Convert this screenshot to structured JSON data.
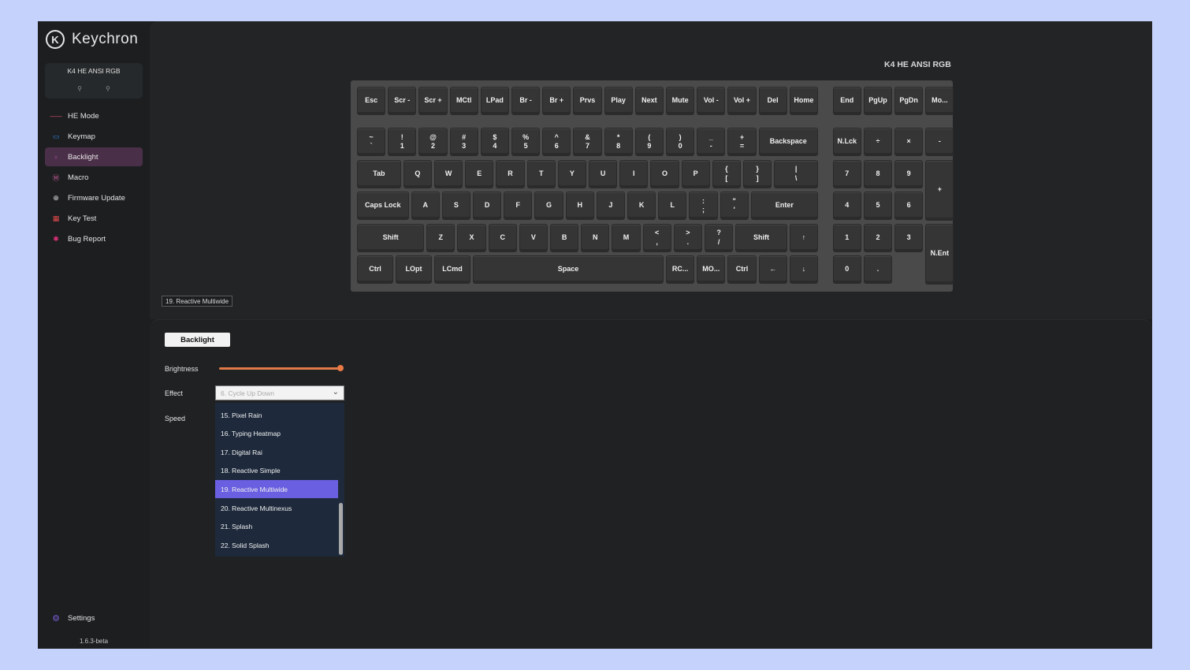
{
  "app": {
    "brand": "Keychron"
  },
  "device": {
    "name": "K4 HE ANSI RGB",
    "icons": [
      "link-icon",
      "link-icon"
    ]
  },
  "sidebar": {
    "items": [
      {
        "label": "HE Mode",
        "icon": "he-mode-icon",
        "color": "#e0506a",
        "glyph": "‒‒‒",
        "active": false
      },
      {
        "label": "Keymap",
        "icon": "keymap-icon",
        "color": "#2f7fd0",
        "glyph": "▭",
        "active": false
      },
      {
        "label": "Backlight",
        "icon": "bulb-icon",
        "color": "#a84ca0",
        "glyph": "♁",
        "active": true
      },
      {
        "label": "Macro",
        "icon": "macro-icon",
        "color": "#d060a0",
        "glyph": "Ⓜ",
        "active": false
      },
      {
        "label": "Firmware Update",
        "icon": "firmware-icon",
        "color": "#dcdcdc",
        "glyph": "⊕",
        "active": false
      },
      {
        "label": "Key Test",
        "icon": "key-test-icon",
        "color": "#e04a4a",
        "glyph": "▦",
        "active": false
      },
      {
        "label": "Bug Report",
        "icon": "bug-icon",
        "color": "#e0307a",
        "glyph": "✱",
        "active": false
      }
    ],
    "settings_label": "Settings",
    "version": "1.6.3-beta"
  },
  "keyboard": {
    "title": "K4 HE ANSI RGB",
    "rows": [
      [
        "Esc",
        "Scr -",
        "Scr +",
        "MCtl",
        "LPad",
        "Br -",
        "Br +",
        "Prvs",
        "Play",
        "Next",
        "Mute",
        "Vol -",
        "Vol +",
        "Del",
        "Home",
        "End",
        "PgUp",
        "PgDn",
        "Mo..."
      ],
      [
        "~\n`",
        "!\n1",
        "@\n2",
        "#\n3",
        "$\n4",
        "%\n5",
        "^\n6",
        "&\n7",
        "*\n8",
        "(\n9",
        ")\n0",
        "_\n-",
        "+\n=",
        "Backspace",
        "N.Lck",
        "÷",
        "×",
        "-"
      ],
      [
        "Tab",
        "Q",
        "W",
        "E",
        "R",
        "T",
        "Y",
        "U",
        "I",
        "O",
        "P",
        "{\n[",
        "}\n]",
        "|\n\\",
        "7",
        "8",
        "9",
        "+"
      ],
      [
        "Caps Lock",
        "A",
        "S",
        "D",
        "F",
        "G",
        "H",
        "J",
        "K",
        "L",
        ":\n;",
        "\"\n'",
        "Enter",
        "4",
        "5",
        "6"
      ],
      [
        "Shift",
        "Z",
        "X",
        "C",
        "V",
        "B",
        "N",
        "M",
        "<\n,",
        ">\n.",
        "?\n/",
        "Shift",
        "↑",
        "1",
        "2",
        "3",
        "N.Ent"
      ],
      [
        "Ctrl",
        "LOpt",
        "LCmd",
        "Space",
        "RC...",
        "MO...",
        "Ctrl",
        "←",
        "↓",
        "→",
        "0",
        "."
      ]
    ]
  },
  "current_effect_tag": "19. Reactive Multiwide",
  "panel": {
    "tab_label": "Backlight",
    "brightness_label": "Brightness",
    "brightness_value": 1.0,
    "effect_label": "Effect",
    "effect_selected": "6. Cycle Up Down",
    "speed_label": "Speed",
    "accent": "#e97a45",
    "effect_options": [
      "15. Pixel Rain",
      "16. Typing Heatmap",
      "17. Digital Rai",
      "18. Reactive Simple",
      "19. Reactive Multiwide",
      "20. Reactive Multinexus",
      "21. Splash",
      "22. Solid Splash"
    ],
    "highlighted_option": "19. Reactive Multiwide"
  }
}
